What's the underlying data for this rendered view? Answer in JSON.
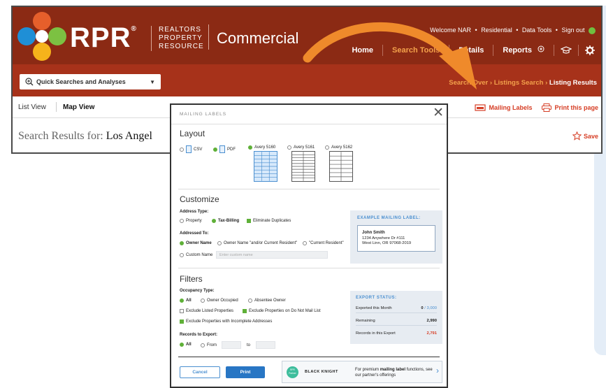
{
  "app": {
    "brand_name": "RPR",
    "brand_reg": "®",
    "brand_sub": [
      "REALTORS",
      "PROPERTY",
      "RESOURCE"
    ],
    "product_name": "Commercial",
    "top_links": [
      "Welcome NAR",
      "Residential",
      "Data Tools",
      "Sign out"
    ],
    "top_sep": "•",
    "nav": [
      "Home",
      "Search Tools",
      "Details",
      "Reports"
    ],
    "quick_search": "Quick Searches and Analyses",
    "breadcrumb": {
      "crumb1": "Search Over",
      "crumb2": "Listings Search",
      "current": "Listing Results",
      "sep": "›"
    },
    "tabs": {
      "list": "List View",
      "map": "Map View"
    },
    "actions": {
      "mailing_labels": "Mailing Labels",
      "print": "Print this page",
      "save": "Save"
    },
    "results_prefix": "Search Results for:",
    "results_query": "Los Angel"
  },
  "modal": {
    "title": "MAILING LABELS",
    "close": "✕",
    "layout": {
      "heading": "Layout",
      "formats": [
        "CSV",
        "PDF"
      ],
      "templates": [
        "Avery 5160",
        "Avery 5161",
        "Avery 5162"
      ]
    },
    "customize": {
      "heading": "Customize",
      "address_type_label": "Address Type:",
      "address_types": [
        "Property",
        "Tax-Billing"
      ],
      "eliminate_duplicates": "Eliminate Duplicates",
      "addressed_to_label": "Addressed To:",
      "addressed_to": [
        "Owner Name",
        "Owner Name \"and/or Current Resident\"",
        "\"Current Resident\"",
        "Custom Name"
      ],
      "custom_name_placeholder": "Enter custom name",
      "example_title": "EXAMPLE MAILING LABEL:",
      "example_name": "John Smith",
      "example_line1": "1234 Anywhere Dr #111",
      "example_line2": "West Linn, OR 97068-2019"
    },
    "filters": {
      "heading": "Filters",
      "occupancy_label": "Occupancy Type:",
      "occupancy": [
        "All",
        "Owner Occupied",
        "Absentee Owner"
      ],
      "exclude_listed": "Exclude Listed Properties",
      "exclude_dnm": "Exclude Properties on Do Not Mail List",
      "exclude_incomplete": "Exclude Properties with Incomplete Addresses",
      "records_label": "Records to Export:",
      "records_all": "All",
      "records_from": "From",
      "records_to": "to"
    },
    "export_status": {
      "title": "EXPORT STATUS:",
      "exported_label": "Exported this Month",
      "exported_value": "0",
      "exported_total": "/ 3,000",
      "remaining_label": "Remaining",
      "remaining_value": "2,990",
      "records_label": "Records in this Export",
      "records_value": "2,791"
    },
    "buttons": {
      "cancel": "Cancel",
      "print": "Print"
    },
    "promo": {
      "badge": "RPR Partner",
      "partner": "BLACK KNIGHT",
      "text_pre": "For premium",
      "text_bold": "mailing label",
      "text_post": "functions, see our partner's offerings",
      "chevron": "›"
    }
  },
  "colors": {
    "header": "#8b2a14",
    "subbar": "#a7321a",
    "accent_orange": "#f3a14b",
    "link_red": "#d63d24",
    "primary_blue": "#2876c4",
    "check_green": "#5fb038"
  }
}
